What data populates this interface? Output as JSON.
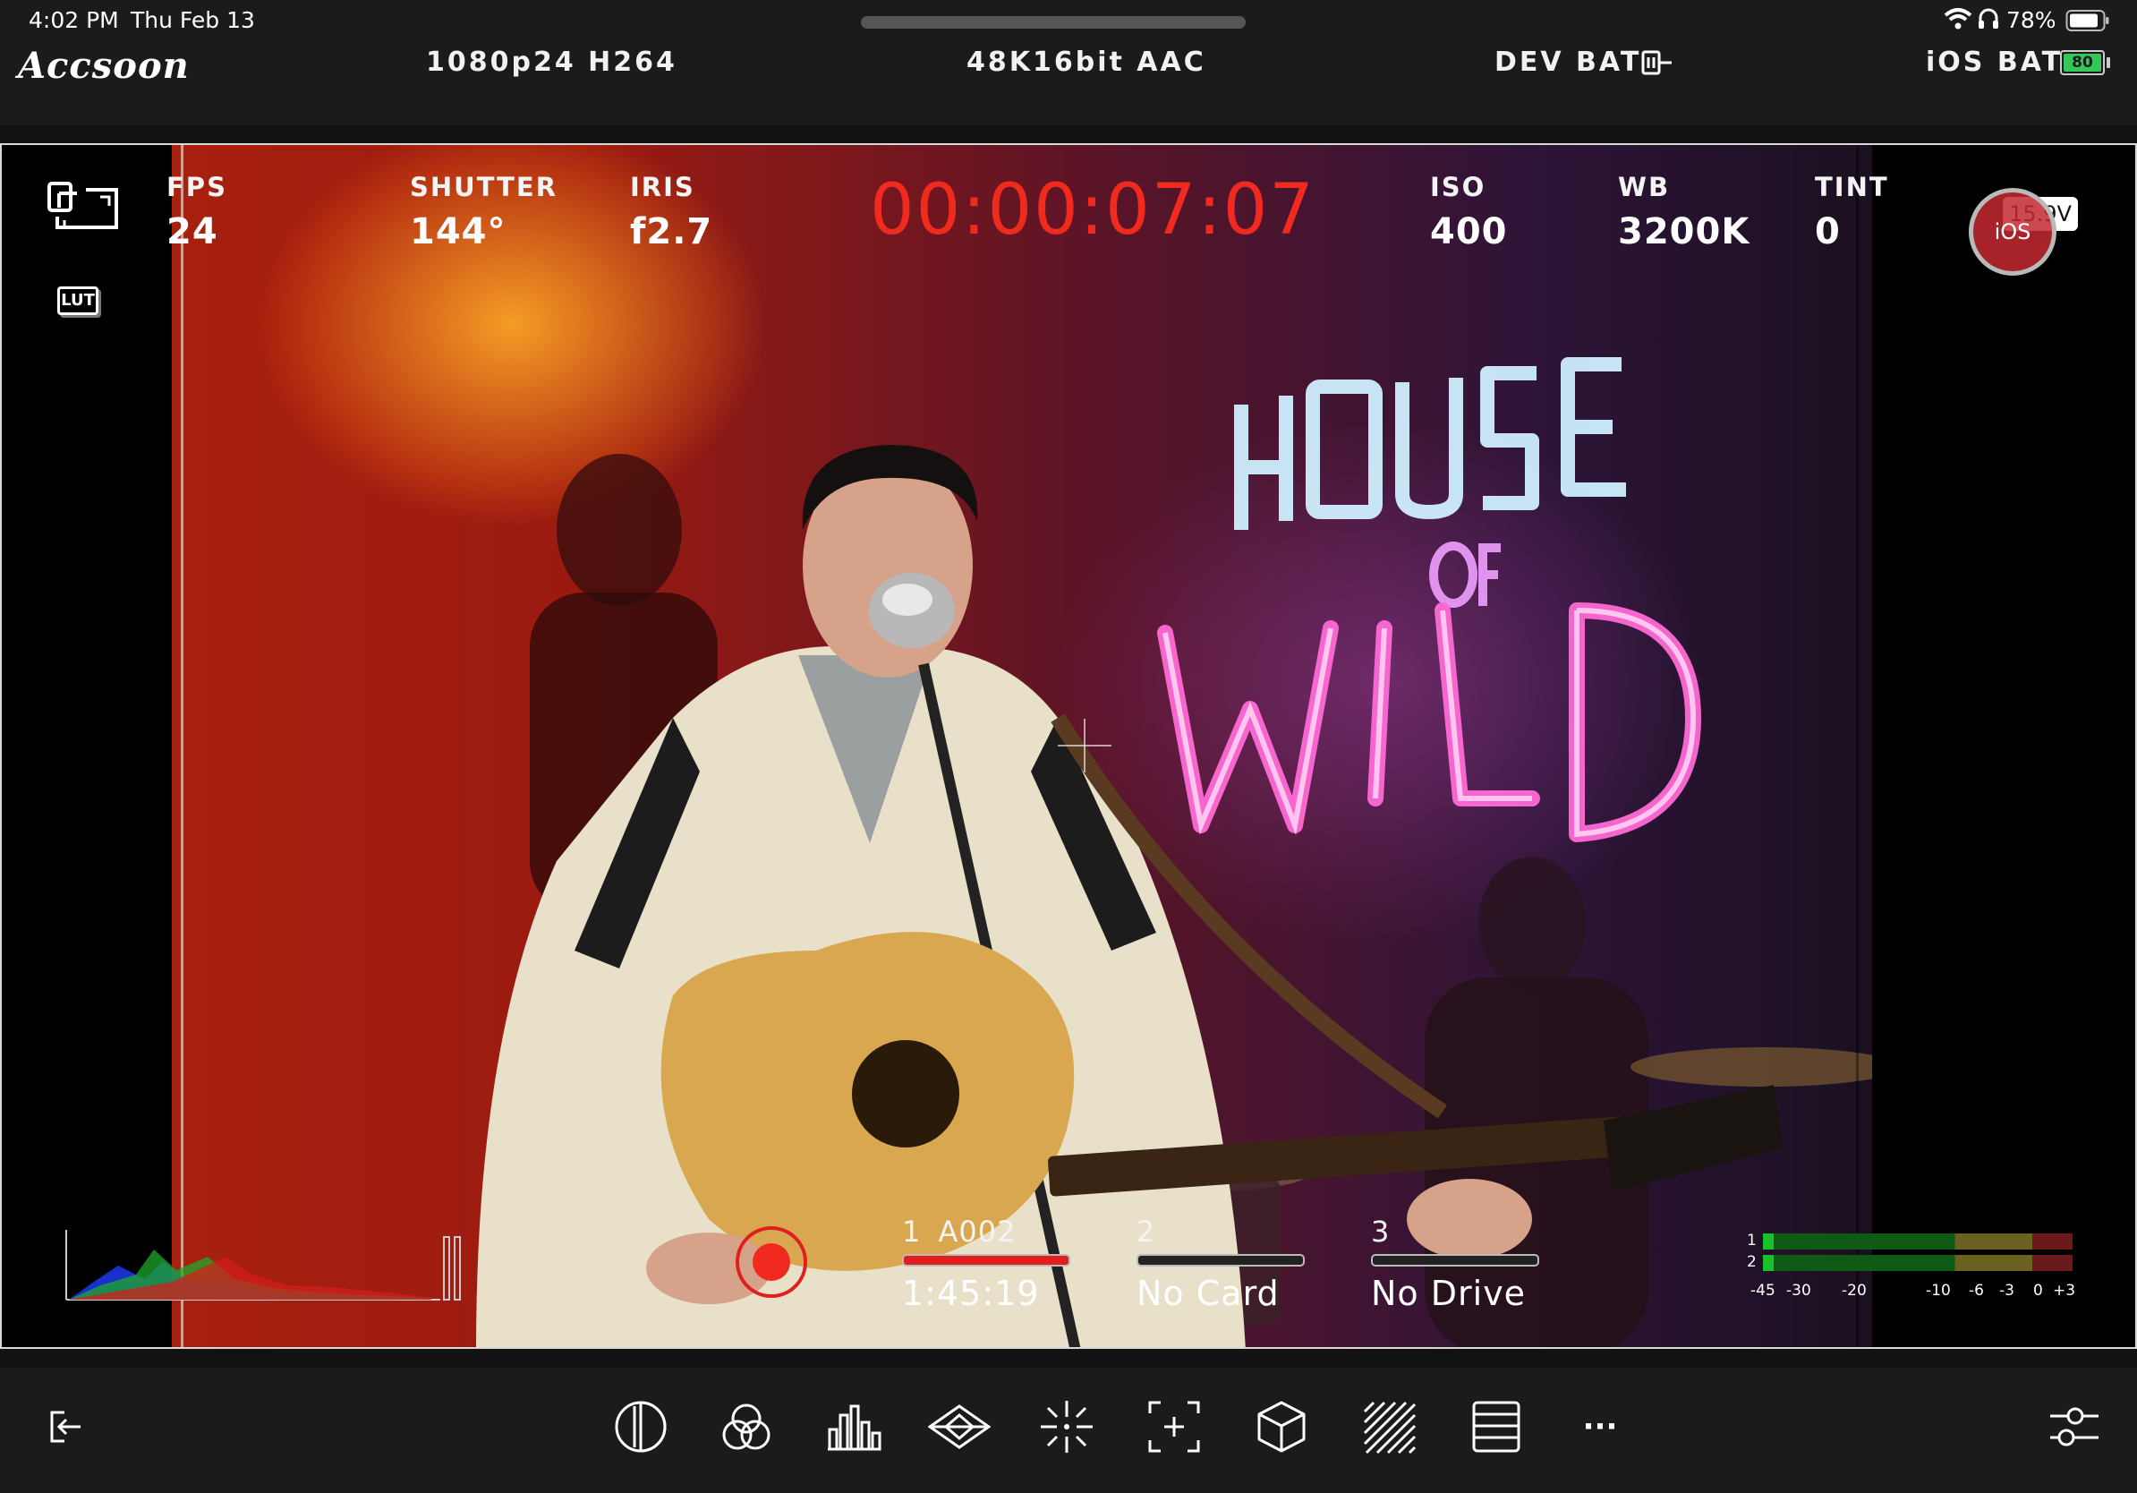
{
  "status_bar": {
    "time": "4:02 PM",
    "date": "Thu Feb 13",
    "battery_percent": "78%"
  },
  "header": {
    "brand": "Accsoon",
    "video_format": "1080p24 H264",
    "audio_format": "48K16bit AAC",
    "dev_bat_label": "DEV BAT",
    "ios_bat_label": "iOS BAT",
    "ios_bat_value": "80"
  },
  "overlay": {
    "fps_label": "FPS",
    "fps_value": "24",
    "shutter_label": "SHUTTER",
    "shutter_value": "144°",
    "iris_label": "IRIS",
    "iris_value": "f2.7",
    "timecode": "00:00:07:07",
    "iso_label": "ISO",
    "iso_value": "400",
    "wb_label": "WB",
    "wb_value": "3200K",
    "tint_label": "TINT",
    "tint_value": "0",
    "lut_label": "LUT",
    "voltage": "15.9V",
    "ios_badge": "iOS"
  },
  "slots": [
    {
      "number": "1",
      "clip": "A002",
      "value": "1:45:19",
      "active": true
    },
    {
      "number": "2",
      "clip": "",
      "value": "No Card",
      "active": false
    },
    {
      "number": "3",
      "clip": "",
      "value": "No Drive",
      "active": false
    }
  ],
  "audio_meter": {
    "channels": [
      "1",
      "2"
    ],
    "scale": [
      "-45",
      "-30",
      "-20",
      "-10",
      "-6",
      "-3",
      "0",
      "+3"
    ]
  },
  "toolbar": {
    "more_label": "···"
  },
  "colors": {
    "accent_red": "#e02020",
    "meter_green": "#19c12b",
    "battery_green": "#34c759"
  }
}
